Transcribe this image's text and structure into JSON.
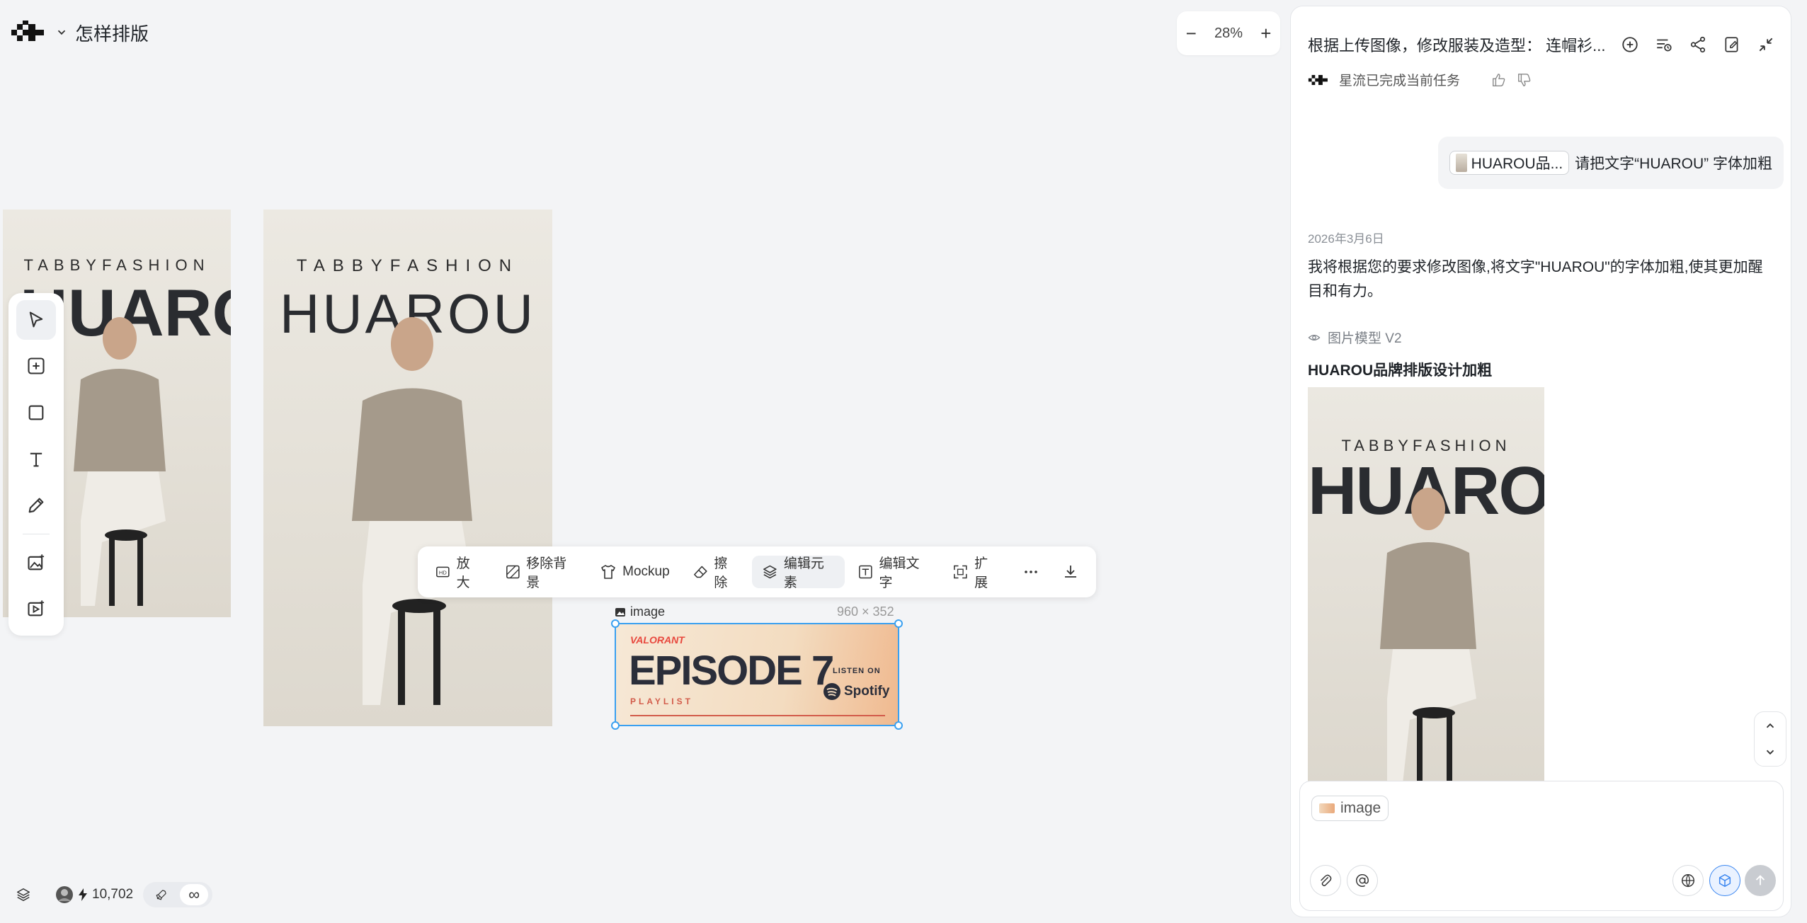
{
  "project": {
    "title": "怎样排版"
  },
  "zoom": {
    "minus": "−",
    "level": "28%",
    "plus": "+"
  },
  "posters": {
    "brand": "TABBYFASHION",
    "big_text": "HUAROU"
  },
  "toolbar": {
    "items": [
      {
        "label": "放大",
        "icon": "hd-icon"
      },
      {
        "label": "移除背景",
        "icon": "remove-bg-icon"
      },
      {
        "label": "Mockup",
        "icon": "shirt-icon"
      },
      {
        "label": "擦除",
        "icon": "eraser-icon"
      },
      {
        "label": "编辑元素",
        "icon": "layers-icon"
      },
      {
        "label": "编辑文字",
        "icon": "text-edit-icon"
      },
      {
        "label": "扩展",
        "icon": "expand-icon"
      }
    ]
  },
  "selection": {
    "label": "image",
    "dims": "960 × 352",
    "episode_brand": "VALORANT",
    "episode_title": "EPISODE 7",
    "episode_sub": "PLAYLIST",
    "listen_on": "LISTEN ON",
    "spotify": "Spotify"
  },
  "bottom": {
    "credits": "10,702",
    "infinity": "∞"
  },
  "panel": {
    "title": "根据上传图像，修改服装及造型： 连帽衫...",
    "status": "星流已完成当前任务",
    "user_msg": {
      "chip": "HUAROU品...",
      "text": "请把文字“HUAROU” 字体加粗"
    },
    "date": "2026年3月6日",
    "reply": "我将根据您的要求修改图像,将文字\"HUAROU\"的字体加粗,使其更加醒目和有力。",
    "model": "图片模型 V2",
    "result_title": "HUAROU品牌排版设计加粗",
    "input_chip": "image"
  },
  "colors": {
    "selection": "#3aa0f0",
    "accent_blue": "#3a86f0"
  }
}
